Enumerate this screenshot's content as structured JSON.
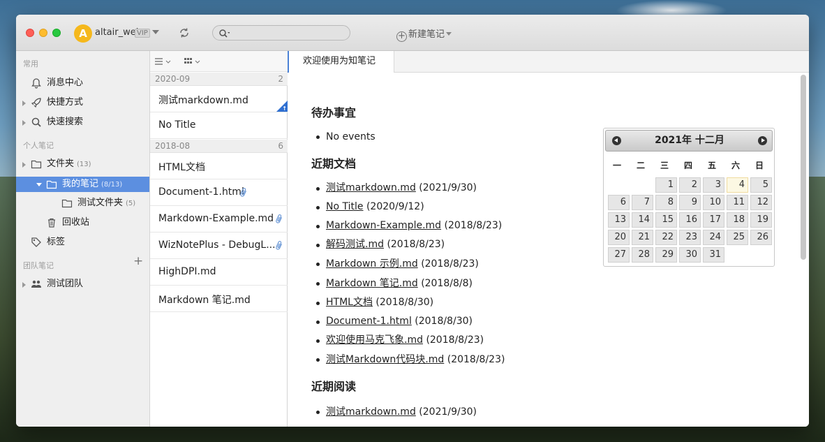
{
  "titlebar": {
    "avatar_letter": "A",
    "username": "altair_wei",
    "vip": "VIP",
    "search_placeholder": "",
    "new_note": "新建笔记"
  },
  "sidebar": {
    "section_common": "常用",
    "messages": "消息中心",
    "shortcuts": "快捷方式",
    "quick_search": "快速搜索",
    "section_personal": "个人笔记",
    "folders": "文件夹",
    "folders_count": "(13)",
    "my_notes": "我的笔记",
    "my_notes_count": "(8/13)",
    "test_folder": "测试文件夹",
    "test_folder_count": "(5)",
    "trash": "回收站",
    "tags": "标签",
    "section_team": "团队笔记",
    "team": "测试团队"
  },
  "notelist": {
    "groups": [
      {
        "date": "2020-09",
        "count": "2"
      },
      {
        "date": "2018-08",
        "count": "6"
      }
    ],
    "items": [
      "测试markdown.md",
      "No Title",
      "HTML文档",
      "Document-1.html",
      "Markdown-Example.md",
      "WizNotePlus - DebugL...",
      "HighDPI.md",
      "Markdown 笔记.md"
    ]
  },
  "editor": {
    "tab": "欢迎使用为知笔记",
    "todo_heading": "待办事宜",
    "todo_items": [
      "No events"
    ],
    "recent_docs_heading": "近期文档",
    "recent_docs": [
      {
        "title": "测试markdown.md",
        "date": "(2021/9/30)"
      },
      {
        "title": "No Title",
        "date": "(2020/9/12)"
      },
      {
        "title": "Markdown-Example.md",
        "date": "(2018/8/23)"
      },
      {
        "title": "解码测试.md",
        "date": "(2018/8/23)"
      },
      {
        "title": "Markdown 示例.md",
        "date": "(2018/8/23)"
      },
      {
        "title": "Markdown 笔记.md",
        "date": "(2018/8/8)"
      },
      {
        "title": "HTML文档",
        "date": "(2018/8/30)"
      },
      {
        "title": "Document-1.html",
        "date": "(2018/8/30)"
      },
      {
        "title": "欢迎使用马克飞象.md",
        "date": "(2018/8/23)"
      },
      {
        "title": "测试Markdown代码块.md",
        "date": "(2018/8/23)"
      }
    ],
    "recent_read_heading": "近期阅读",
    "recent_read": [
      {
        "title": "测试markdown.md",
        "date": "(2021/9/30)"
      }
    ]
  },
  "calendar": {
    "title": "2021年 十二月",
    "weekdays": [
      "一",
      "二",
      "三",
      "四",
      "五",
      "六",
      "日"
    ],
    "today": "4",
    "days": [
      "1",
      "2",
      "3",
      "4",
      "5",
      "6",
      "7",
      "8",
      "9",
      "10",
      "11",
      "12",
      "13",
      "14",
      "15",
      "16",
      "17",
      "18",
      "19",
      "20",
      "21",
      "22",
      "23",
      "24",
      "25",
      "26",
      "27",
      "28",
      "29",
      "30",
      "31"
    ]
  }
}
